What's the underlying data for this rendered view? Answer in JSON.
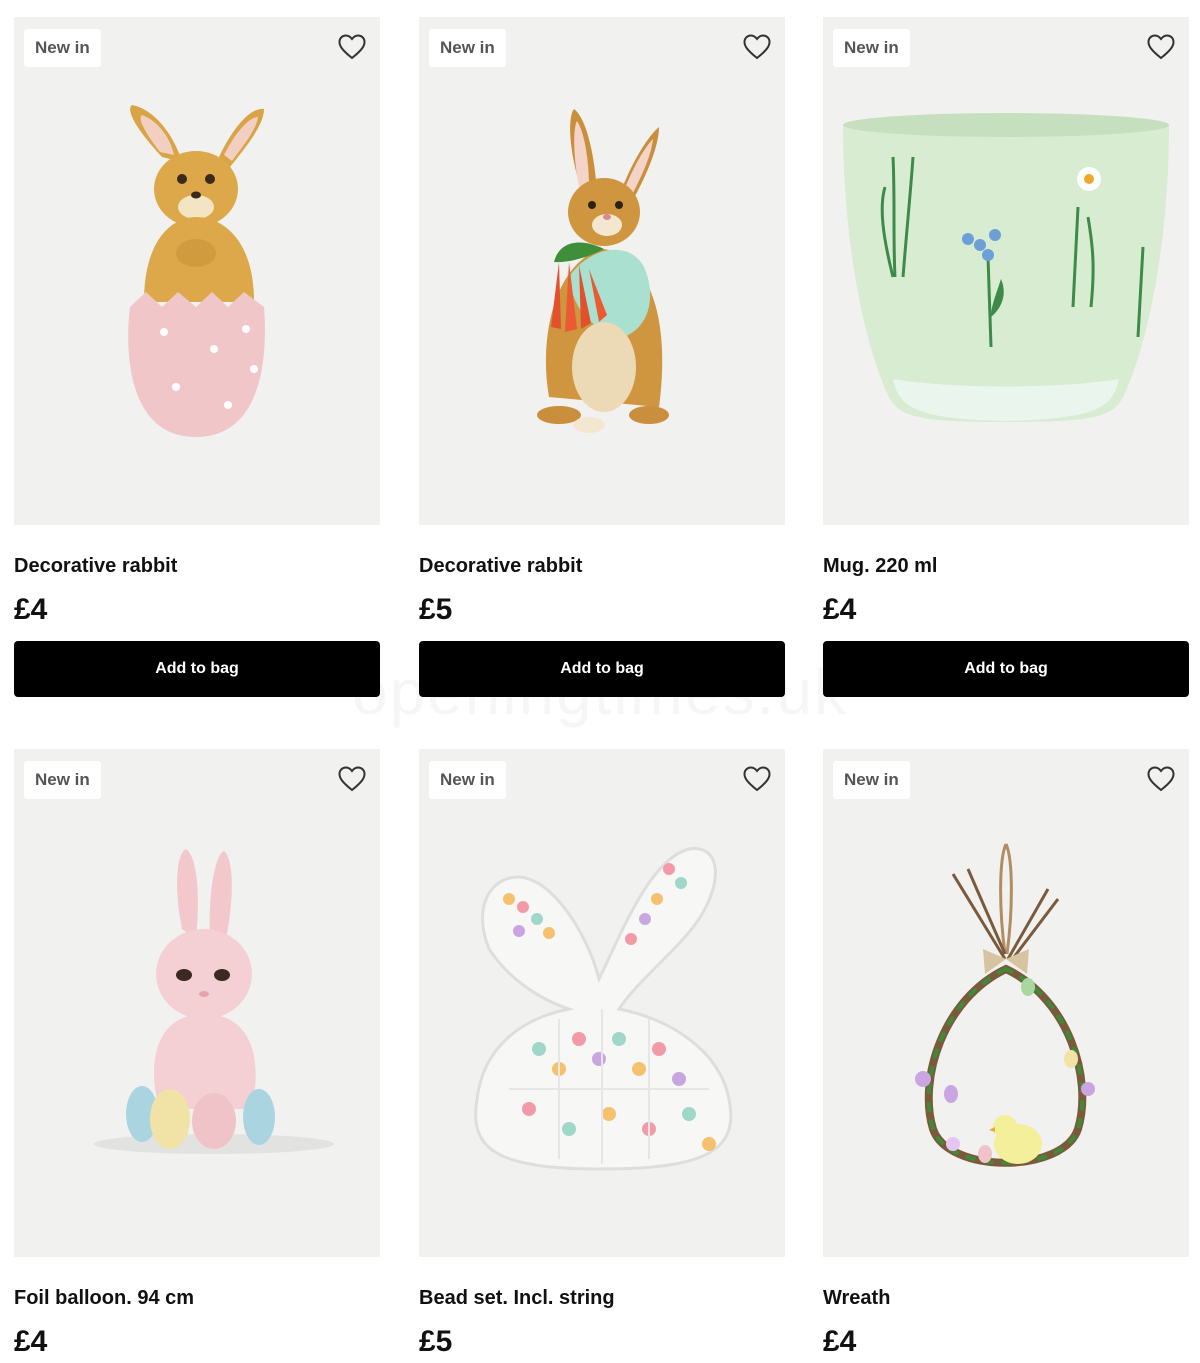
{
  "products": [
    {
      "badge": "New in",
      "name": "Decorative rabbit",
      "price": "£4",
      "cta": "Add to bag",
      "image": "rabbit-in-pink-egg"
    },
    {
      "badge": "New in",
      "name": "Decorative rabbit",
      "price": "£5",
      "cta": "Add to bag",
      "image": "rabbit-with-carrots"
    },
    {
      "badge": "New in",
      "name": "Mug. 220 ml",
      "price": "£4",
      "cta": "Add to bag",
      "image": "green-floral-mug"
    },
    {
      "badge": "New in",
      "name": "Foil balloon. 94 cm",
      "price": "£4",
      "image": "pink-bunny-balloon"
    },
    {
      "badge": "New in",
      "name": "Bead set. Incl. string",
      "price": "£5",
      "image": "bunny-bead-box"
    },
    {
      "badge": "New in",
      "name": "Wreath",
      "price": "£4",
      "image": "easter-wreath"
    }
  ],
  "icons": {
    "favourite": "heart-outline-icon"
  },
  "watermark": "openingtimes.uk"
}
